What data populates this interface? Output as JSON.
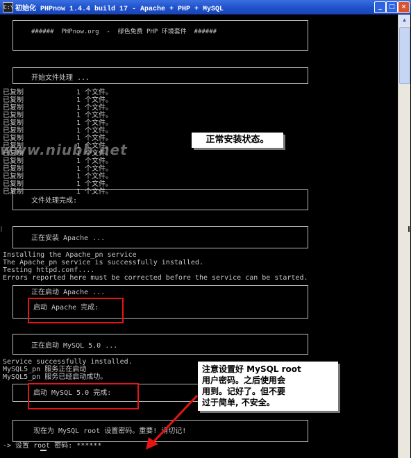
{
  "window": {
    "title": "初始化 PHPnow 1.4.4 build 17 - Apache + PHP + MySQL",
    "icon_glyph": "C:\\",
    "controls": {
      "minimize": "_",
      "maximize": "□",
      "close": "×"
    }
  },
  "console": {
    "banner": "######  PHPnow.org  -  绿色免费 PHP 环境套件  ######",
    "file_start": "开始文件处理 ...",
    "copied_label": "已复制",
    "copied_count": "1 个文件。",
    "copied_repeat": 14,
    "file_done": "文件处理完成:",
    "apache_installing": "正在安装 Apache ...",
    "apache_log": [
      "Installing the Apache_pn service",
      "The Apache_pn service is successfully installed.",
      "Testing httpd.conf....",
      "Errors reported here must be corrected before the service can be started."
    ],
    "apache_starting": "正在启动 Apache ...",
    "apache_done": "启动 Apache 完成:",
    "mysql_starting": "正在启动 MySQL 5.0 ...",
    "mysql_log": [
      "Service successfully installed.",
      "MySQL5_pn 服务正在启动",
      "MySQL5_pn 服务已经启动成功。"
    ],
    "mysql_done": "启动 MySQL 5.0 完成:",
    "set_root_notice": "现在为 MySQL root 设置密码。重要! 请切记!",
    "prompt": "-> 设置 root 密码: ******"
  },
  "annotations": {
    "normal_state": "正常安装状态。",
    "mysql_note": [
      "注意设置好 MySQL root",
      "用户密码。之后使用会",
      "用到。记好了。但不要",
      "过于简单, 不安全。"
    ]
  },
  "watermark": "www.niubb.net",
  "colors": {
    "console_bg": "#000000",
    "console_text": "#c8c8c8",
    "titlebar": "#1d4fc9",
    "highlight_red": "#e51515",
    "arrow_red": "#e51515"
  }
}
